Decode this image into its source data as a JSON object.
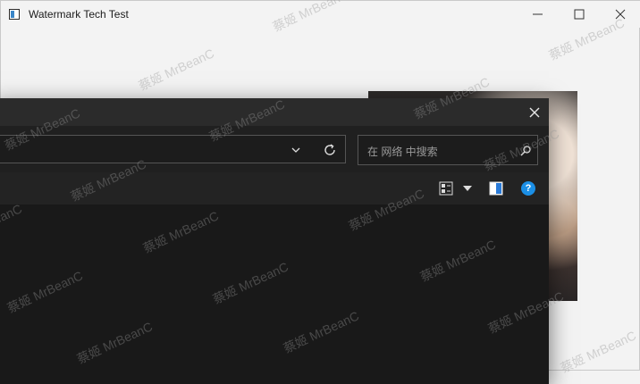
{
  "window": {
    "title": "Watermark Tech Test"
  },
  "dialog": {
    "search_placeholder": "在 网络 中搜索",
    "help_label": "?"
  },
  "watermark": {
    "text": "蔡姬 MrBeanC"
  }
}
